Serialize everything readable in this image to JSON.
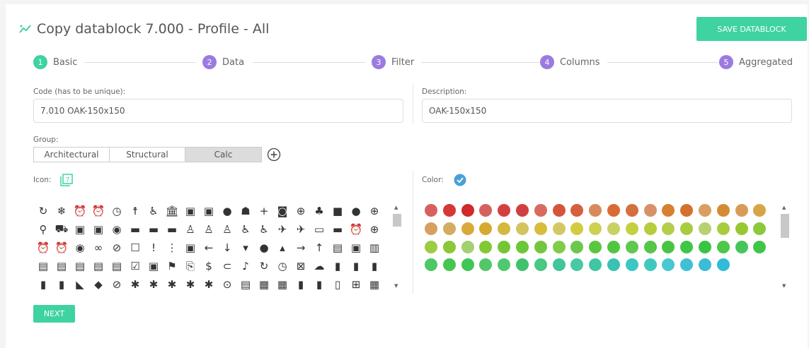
{
  "header": {
    "title": "Copy datablock 7.000 - Profile - All",
    "save_label": "SAVE DATABLOCK",
    "icon": "chart-line-icon"
  },
  "steps": [
    {
      "num": "1",
      "label": "Basic",
      "color": "#3ed3a0"
    },
    {
      "num": "2",
      "label": "Data",
      "color": "#9b7be0"
    },
    {
      "num": "3",
      "label": "Filter",
      "color": "#9b7be0"
    },
    {
      "num": "4",
      "label": "Columns",
      "color": "#9b7be0"
    },
    {
      "num": "5",
      "label": "Aggregated",
      "color": "#9b7be0"
    }
  ],
  "form": {
    "code_label": "Code (has to be unique):",
    "code_value": "7.010 OAK-150x150",
    "description_label": "Description:",
    "description_value": "OAK-150x150",
    "group_label": "Group:",
    "groups": [
      "Architectural",
      "Structural",
      "Calc"
    ],
    "selected_group": "Calc",
    "icon_label": "Icon:",
    "selected_icon": "7",
    "color_label": "Color:"
  },
  "icons": [
    "↻",
    "❄",
    "⏰",
    "⏰",
    "◷",
    "☨",
    "♿",
    "🏛",
    "▣",
    "▣",
    "●",
    "☗",
    "+",
    "◙",
    "⊕",
    "♣",
    "■",
    "●",
    "⊕",
    "⚲",
    "⛟",
    "▣",
    "▣",
    "◉",
    "▬",
    "▬",
    "▬",
    "♙",
    "♙",
    "♙",
    "♿",
    "♿",
    "✈",
    "✈",
    "▭",
    "▬",
    "⏰",
    "⊕",
    "⏰",
    "⏰",
    "◉",
    "∞",
    "⊘",
    "☐",
    "!",
    "⋮",
    "▣",
    "←",
    "↓",
    "▾",
    "●",
    "▴",
    "→",
    "↑",
    "▤",
    "▣",
    "▥",
    "▤",
    "▤",
    "▤",
    "▤",
    "▤",
    "☑",
    "▣",
    "⚑",
    "⎘",
    "$",
    "⊂",
    "♪",
    "↻",
    "◷",
    "⊠",
    "☁",
    "▮",
    "▮",
    "▮",
    "▮",
    "▮",
    "◣",
    "◆",
    "⊘",
    "✱",
    "✱",
    "✱",
    "✱",
    "✱",
    "⊙",
    "▤",
    "▦",
    "▦",
    "▮",
    "▮",
    "▯",
    "⊞",
    "▦"
  ],
  "colors": [
    "#d86060",
    "#d43838",
    "#d02a2a",
    "#d46060",
    "#d44040",
    "#d04040",
    "#d86a60",
    "#d4553a",
    "#d4603e",
    "#d88a5e",
    "#d96c34",
    "#d4703e",
    "#d8906a",
    "#d68032",
    "#d4702e",
    "#d8a060",
    "#d48c34",
    "#d89c58",
    "#d8a448",
    "#d6a060",
    "#d3ac60",
    "#d8aa38",
    "#d6aa30",
    "#d4b840",
    "#d4c460",
    "#d8bc3c",
    "#d4c864",
    "#d2cc40",
    "#ccd250",
    "#c8d264",
    "#c4d040",
    "#b8cc3c",
    "#b4ce4c",
    "#a8cc40",
    "#b8d070",
    "#a8cc40",
    "#98c830",
    "#8cc83c",
    "#9ccc44",
    "#8ac838",
    "#a4d070",
    "#80c834",
    "#74c634",
    "#6ac838",
    "#74c640",
    "#80cc48",
    "#6ac84c",
    "#5ac640",
    "#50c640",
    "#60c850",
    "#54c648",
    "#48c444",
    "#40c646",
    "#38c444",
    "#4ec84a",
    "#44c65a",
    "#40c646",
    "#4cc864",
    "#44c650",
    "#40c654",
    "#50c866",
    "#50c870",
    "#40c26c",
    "#48c880",
    "#40c69a",
    "#48c8a4",
    "#40c6a4",
    "#38c2b4",
    "#3cc6c6",
    "#40c8c0",
    "#48c8d0",
    "#40c0d4",
    "#3cbcd6",
    "#30bcd8"
  ]
}
